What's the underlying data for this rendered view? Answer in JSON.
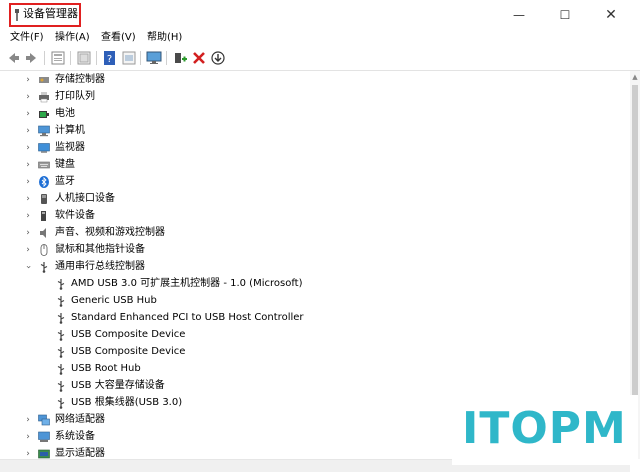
{
  "window": {
    "title": "设备管理器",
    "controls": {
      "minimize": "—",
      "maximize": "☐",
      "close": "✕"
    }
  },
  "menu": [
    "文件(F)",
    "操作(A)",
    "查看(V)",
    "帮助(H)"
  ],
  "toolbar": {
    "icons": [
      "back-icon",
      "forward-icon",
      "properties-icon",
      "scan-icon",
      "help-icon",
      "show-hidden-icon",
      "monitor-icon",
      "add-driver-icon",
      "uninstall-icon",
      "update-driver-icon"
    ]
  },
  "tree": {
    "categories_top": [
      {
        "label": "存储控制器",
        "icon": "storage-icon"
      },
      {
        "label": "打印队列",
        "icon": "printer-icon"
      },
      {
        "label": "电池",
        "icon": "battery-icon"
      },
      {
        "label": "计算机",
        "icon": "computer-icon"
      },
      {
        "label": "监视器",
        "icon": "monitor-icon"
      },
      {
        "label": "键盘",
        "icon": "keyboard-icon"
      },
      {
        "label": "蓝牙",
        "icon": "bluetooth-icon"
      },
      {
        "label": "人机接口设备",
        "icon": "hid-icon"
      },
      {
        "label": "软件设备",
        "icon": "software-device-icon"
      },
      {
        "label": "声音、视频和游戏控制器",
        "icon": "sound-icon"
      },
      {
        "label": "鼠标和其他指针设备",
        "icon": "mouse-icon"
      }
    ],
    "expanded": {
      "label": "通用串行总线控制器",
      "icon": "usb-icon"
    },
    "usb_children": [
      "AMD USB 3.0 可扩展主机控制器 - 1.0 (Microsoft)",
      "Generic USB Hub",
      "Standard Enhanced PCI to USB Host Controller",
      "USB Composite Device",
      "USB Composite Device",
      "USB Root Hub",
      "USB 大容量存储设备",
      "USB 根集线器(USB 3.0)"
    ],
    "categories_bottom": [
      {
        "label": "网络适配器",
        "icon": "network-icon"
      },
      {
        "label": "系统设备",
        "icon": "system-icon"
      },
      {
        "label": "显示适配器",
        "icon": "display-adapter-icon"
      }
    ]
  },
  "watermark": "ITOPM"
}
